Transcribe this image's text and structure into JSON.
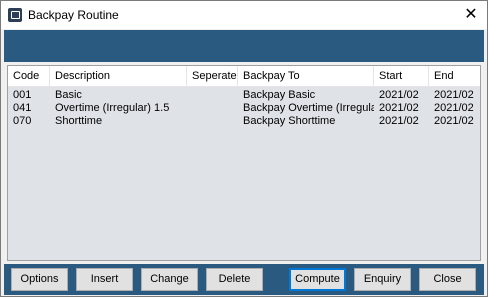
{
  "window": {
    "title": "Backpay Routine",
    "close_glyph": "✕"
  },
  "grid": {
    "columns": [
      "Code",
      "Description",
      "Seperate",
      "Backpay To",
      "Start",
      "End"
    ],
    "rows": [
      {
        "code": "001",
        "description": "Basic",
        "seperate": "",
        "backpay_to": "Backpay Basic",
        "start": "2021/02",
        "end": "2021/02"
      },
      {
        "code": "041",
        "description": "Overtime (Irregular) 1.5",
        "seperate": "",
        "backpay_to": "Backpay Overtime (Irregular)",
        "start": "2021/02",
        "end": "2021/02"
      },
      {
        "code": "070",
        "description": "Shorttime",
        "seperate": "",
        "backpay_to": "Backpay Shorttime",
        "start": "2021/02",
        "end": "2021/02"
      }
    ]
  },
  "buttons": {
    "options": "Options",
    "insert": "Insert",
    "change": "Change",
    "delete": "Delete",
    "compute": "Compute",
    "enquiry": "Enquiry",
    "close": "Close"
  },
  "colors": {
    "accent": "#2b5a80",
    "grid_bg": "#dfe3e8",
    "focus": "#0078d7"
  },
  "icons": {
    "app": "backpay-app-icon",
    "close": "close-icon"
  }
}
